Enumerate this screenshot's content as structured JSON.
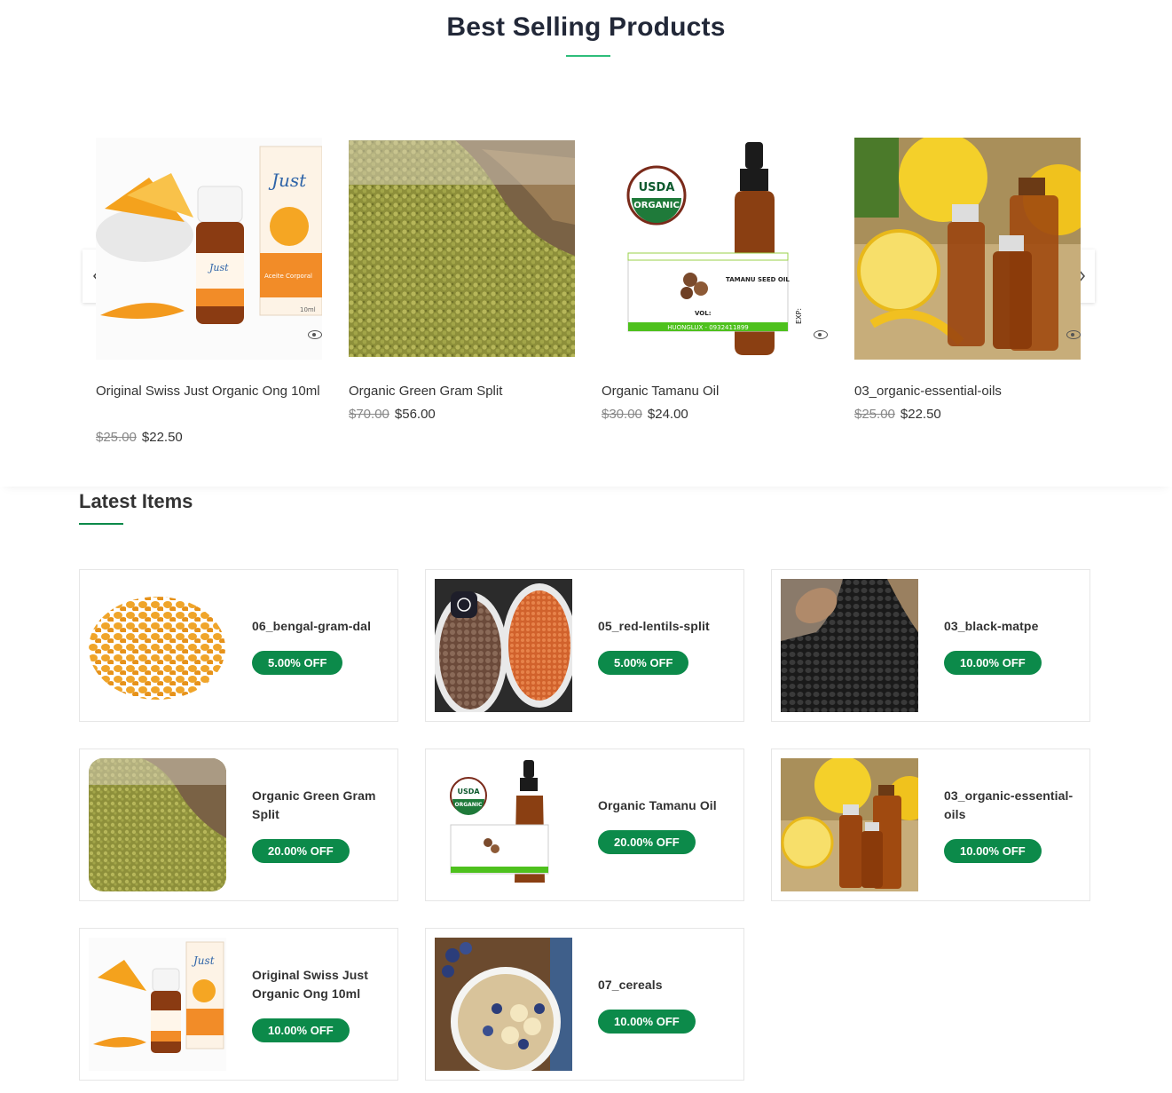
{
  "best_selling": {
    "title": "Best Selling Products",
    "prev_icon": "chevron-left-icon",
    "next_icon": "chevron-right-icon",
    "products": [
      {
        "name": "Original Swiss Just Organic Ong 10ml",
        "old_price": "$25.00",
        "price": "$22.50"
      },
      {
        "name": "Organic Green Gram Split",
        "old_price": "$70.00",
        "price": "$56.00"
      },
      {
        "name": "Organic Tamanu Oil",
        "old_price": "$30.00",
        "price": "$24.00"
      },
      {
        "name": "03_organic-essential-oils",
        "old_price": "$25.00",
        "price": "$22.50"
      }
    ]
  },
  "latest": {
    "title": "Latest Items",
    "items": [
      {
        "name": "06_bengal-gram-dal",
        "badge": "5.00% OFF"
      },
      {
        "name": "05_red-lentils-split",
        "badge": "5.00% OFF"
      },
      {
        "name": "03_black-matpe",
        "badge": "10.00% OFF"
      },
      {
        "name": "Organic Green Gram Split",
        "badge": "20.00% OFF"
      },
      {
        "name": "Organic Tamanu Oil",
        "badge": "20.00% OFF"
      },
      {
        "name": "03_organic-essential-oils",
        "badge": "10.00% OFF"
      },
      {
        "name": "Original Swiss Just Organic Ong 10ml",
        "badge": "10.00% OFF"
      },
      {
        "name": "07_cereals",
        "badge": "10.00% OFF"
      }
    ]
  },
  "labels": {
    "usda_line1": "USDA",
    "usda_line2": "ORGANIC",
    "tamanu_label": "TAMANU SEED OIL",
    "vol": "VOL:",
    "brand_strip": "HUONGLUX - 0932411899",
    "exp": "EXP:",
    "just_brand": "Just",
    "just_sub": "Aceite Corporal",
    "just_volume": "10ml"
  },
  "colors": {
    "accent": "#2ebd7a",
    "badge": "#0c8a4a",
    "title": "#222838"
  }
}
